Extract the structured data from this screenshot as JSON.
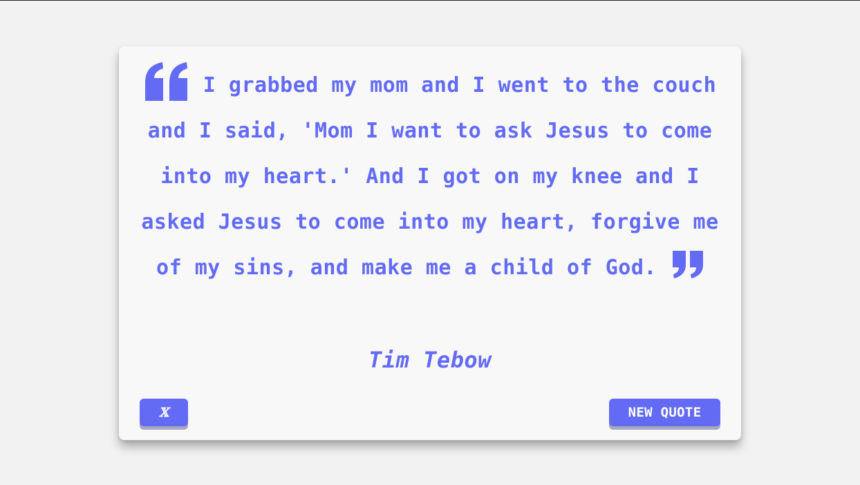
{
  "quote": {
    "text": "I grabbed my mom and I went to the couch and I said, 'Mom I want to ask Jesus to come into my heart.' And I got on my knee and I asked Jesus to come into my heart, forgive me of my sins, and make me a child of God.",
    "author": "Tim Tebow",
    "open_icon": "quote-left-icon",
    "close_icon": "quote-right-icon"
  },
  "buttons": {
    "share_label": "𝕏",
    "share_icon": "x-logo-icon",
    "new_quote_label": "NEW QUOTE"
  },
  "colors": {
    "accent": "#636bf5",
    "background": "#f2f2f2",
    "card": "#f8f8f8",
    "button_shadow": "#a7a9bd"
  }
}
